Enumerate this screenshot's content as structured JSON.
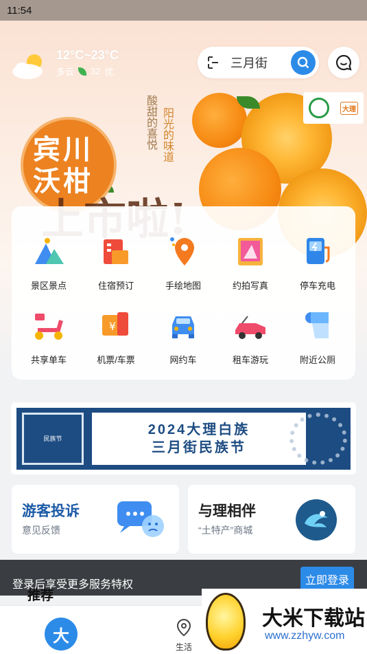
{
  "status_bar": {
    "time": "11:54"
  },
  "weather": {
    "temp": "12°C~23°C",
    "condition": "多云",
    "aqi_value": "32",
    "aqi_label": "优"
  },
  "search": {
    "text": "三月街"
  },
  "banner": {
    "title": "宾川沃柑",
    "sub_text_1": "阳光的味道",
    "sub_text_2": "酸甜的喜悦",
    "big_text": "上市啦!",
    "partner_logo_text": "大理"
  },
  "services": [
    {
      "label": "景区景点",
      "icon": "mountain-icon"
    },
    {
      "label": "住宿预订",
      "icon": "hotel-icon"
    },
    {
      "label": "手绘地图",
      "icon": "map-pin-icon"
    },
    {
      "label": "约拍写真",
      "icon": "photo-icon"
    },
    {
      "label": "停车充电",
      "icon": "ev-charger-icon"
    },
    {
      "label": "共享单车",
      "icon": "scooter-icon"
    },
    {
      "label": "机票/车票",
      "icon": "ticket-icon"
    },
    {
      "label": "网约车",
      "icon": "car-icon"
    },
    {
      "label": "租车游玩",
      "icon": "convertible-icon"
    },
    {
      "label": "附近公厕",
      "icon": "toilet-paper-icon"
    }
  ],
  "festival_banner": {
    "line1": "2024大理白族",
    "line2": "三月街民族节",
    "seal_text": "民族节"
  },
  "cards": [
    {
      "title": "游客投诉",
      "subtitle": "意见反馈",
      "icon": "chat-complaint-icon"
    },
    {
      "title": "与理相伴",
      "subtitle": "“土特产”商城",
      "icon": "shop-logo-icon"
    }
  ],
  "login_bar": {
    "text": "登录后享受更多服务特权",
    "button": "立即登录"
  },
  "section_title": "推荐",
  "tabbar": {
    "home_glyph": "大",
    "life_label": "生活"
  },
  "watermark": {
    "title": "大米下载站",
    "url": "www.zzhyw.com"
  },
  "colors": {
    "accent": "#2d8be8",
    "dark_blue": "#1d4c82",
    "orange": "#ec8220"
  }
}
